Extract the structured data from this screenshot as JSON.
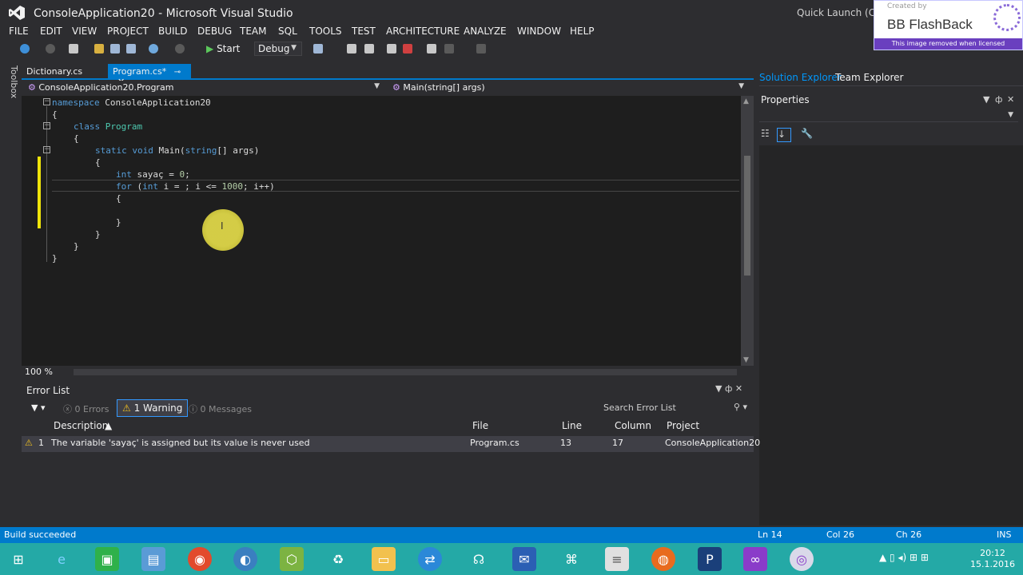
{
  "window": {
    "title": "ConsoleApplication20 - Microsoft Visual Studio",
    "quick_launch": "Quick Launch (Ctrl+"
  },
  "watermark": {
    "created_by": "Created by",
    "brand": "BB FlashBack",
    "notice": "This image removed when licensed"
  },
  "menu": [
    "FILE",
    "EDIT",
    "VIEW",
    "PROJECT",
    "BUILD",
    "DEBUG",
    "TEAM",
    "SQL",
    "TOOLS",
    "TEST",
    "ARCHITECTURE",
    "ANALYZE",
    "WINDOW",
    "HELP"
  ],
  "toolbar": {
    "start_label": "Start",
    "config_value": "Debug"
  },
  "toolbox": {
    "label": "Toolbox"
  },
  "doc_tabs": {
    "tab1": "Dictionary.cs",
    "tab2": "Program.cs*",
    "pin": "⊸",
    "close": "✕"
  },
  "navbar": {
    "class_value": "ConsoleApplication20.Program",
    "member_value": "Main(string[] args)"
  },
  "code": {
    "l1_kw": "namespace",
    "l1_rest": " ConsoleApplication20",
    "l2": "{",
    "l3_kw": "class",
    "l3_ty": " Program",
    "l4": "{",
    "l5_kw": "static void",
    "l5_rest": " Main(",
    "l5_kw2": "string",
    "l5_rest2": "[] args)",
    "l6": "{",
    "l7_kw": "int",
    "l7_rest": " sayaç = ",
    "l7_num": "0",
    "l7_end": ";",
    "l8_kw": "for",
    "l8_a": " (",
    "l8_kw2": "int",
    "l8_b": " i = ; i <= ",
    "l8_num": "1000",
    "l8_c": "; i++)",
    "l9": "{",
    "l10": "}",
    "l11": "}",
    "l12": "}",
    "l13": "}"
  },
  "editor": {
    "zoom": "100 %"
  },
  "right_panel": {
    "solution_explorer": "Solution Explorer",
    "team_explorer": "Team Explorer",
    "properties": "Properties"
  },
  "error_list": {
    "title": "Error List",
    "errors": "0 Errors",
    "warnings": "1 Warning",
    "messages": "0 Messages",
    "search_placeholder": "Search Error List",
    "columns": {
      "description": "Description",
      "file": "File",
      "line": "Line",
      "column": "Column",
      "project": "Project"
    },
    "rows": [
      {
        "index": "1",
        "description": "The variable 'sayaç' is assigned but its value is never used",
        "file": "Program.cs",
        "line": "13",
        "column": "17",
        "project": "ConsoleApplication20"
      }
    ]
  },
  "statusbar": {
    "message": "Build succeeded",
    "ln": "Ln 14",
    "col": "Col 26",
    "ch": "Ch 26",
    "mode": "INS"
  },
  "taskbar": {
    "time": "20:12",
    "date": "15.1.2016"
  },
  "colors": {
    "accent": "#007acc",
    "editor_bg": "#1e1e1e",
    "chrome_bg": "#2d2d30",
    "taskbar": "#24a9a6",
    "change_bar": "#efe40a"
  }
}
